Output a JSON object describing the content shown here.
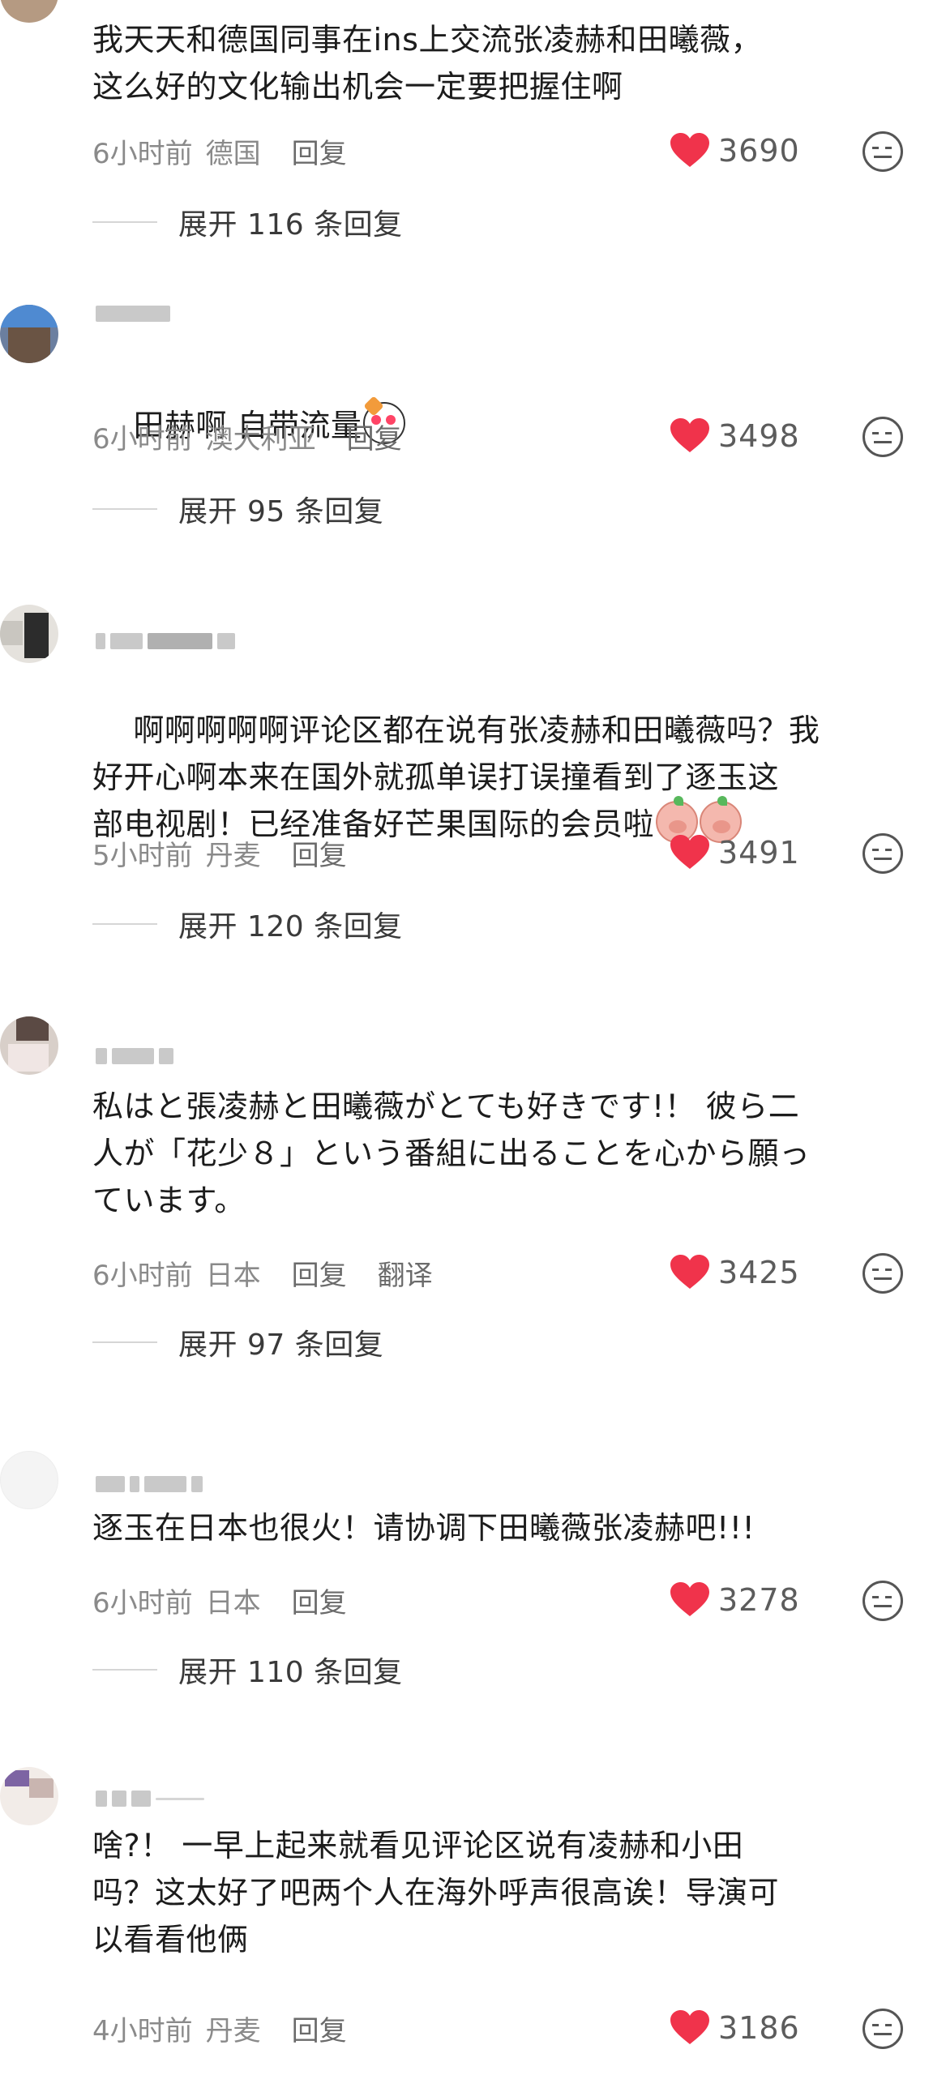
{
  "comments": [
    {
      "text": "我天天和德国同事在ins上交流张凌赫和田曦薇，\n这么好的文化输出机会一定要把握住啊",
      "time": "6小时前",
      "location": "德国",
      "reply": "回复",
      "likes": "3690",
      "expand": "展开 116 条回复"
    },
    {
      "text": "田赫啊 自带流量",
      "time": "6小时前",
      "location": "澳大利亚",
      "reply": "回复",
      "likes": "3498",
      "expand": "展开 95 条回复"
    },
    {
      "text": "啊啊啊啊啊评论区都在说有张凌赫和田曦薇吗？我\n好开心啊本来在国外就孤单误打误撞看到了逐玉这\n部电视剧！已经准备好芒果国际的会员啦",
      "time": "5小时前",
      "location": "丹麦",
      "reply": "回复",
      "likes": "3491",
      "expand": "展开 120 条回复"
    },
    {
      "text": "私はと張凌赫と田曦薇がとても好きです!！ 彼ら二\n人が「花少８」という番組に出ることを心から願っ\nています。",
      "time": "6小时前",
      "location": "日本",
      "reply": "回复",
      "translate": "翻译",
      "likes": "3425",
      "expand": "展开 97 条回复"
    },
    {
      "text": "逐玉在日本也很火！请协调下田曦薇张凌赫吧!!!",
      "time": "6小时前",
      "location": "日本",
      "reply": "回复",
      "likes": "3278",
      "expand": "展开 110 条回复"
    },
    {
      "text": "啥?！ 一早上起来就看见评论区说有凌赫和小田\n吗？这太好了吧两个人在海外呼声很高诶！导演可\n以看看他俩",
      "time": "4小时前",
      "location": "丹麦",
      "reply": "回复",
      "likes": "3186"
    }
  ],
  "colors": {
    "heart": "#f0334b",
    "meta": "#8a8a8a"
  }
}
